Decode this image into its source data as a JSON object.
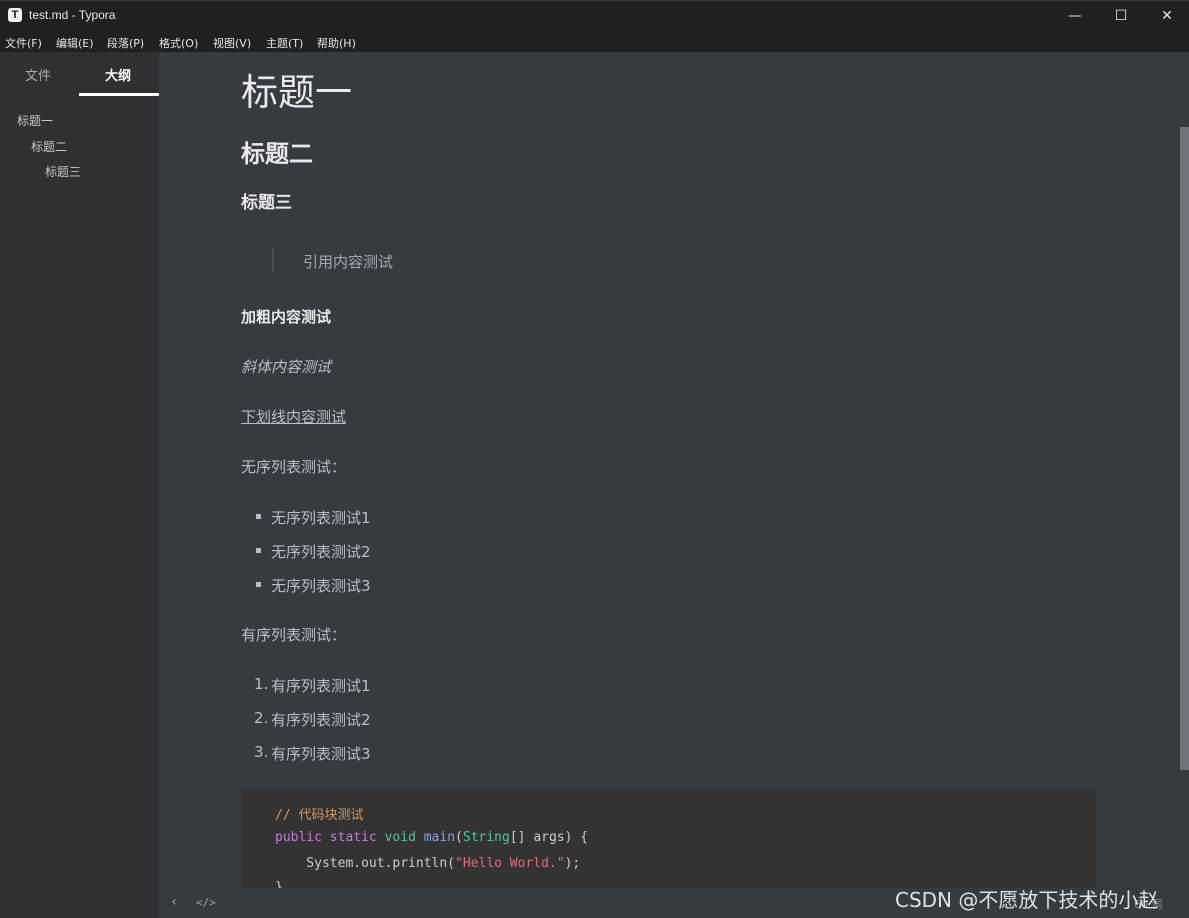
{
  "window": {
    "title": "test.md - Typora",
    "app_icon": "T",
    "controls": {
      "minimize": "—",
      "maximize": "☐",
      "close": "✕"
    }
  },
  "menu": [
    "文件(F)",
    "编辑(E)",
    "段落(P)",
    "格式(O)",
    "视图(V)",
    "主题(T)",
    "帮助(H)"
  ],
  "sidebar": {
    "tabs": {
      "files": "文件",
      "outline": "大纲"
    },
    "active_tab": "outline",
    "outline": [
      "标题一",
      "标题二",
      "标题三"
    ]
  },
  "document": {
    "h1": "标题一",
    "h2": "标题二",
    "h3": "标题三",
    "quote": "引用内容测试",
    "bold": "加粗内容测试",
    "italic": "斜体内容测试",
    "underline": "下划线内容测试",
    "ul_intro": "无序列表测试：",
    "ul": [
      "无序列表测试1",
      "无序列表测试2",
      "无序列表测试3"
    ],
    "ol_intro": "有序列表测试：",
    "ol_numbers": [
      "1.",
      "2.",
      "3."
    ],
    "ol": [
      "有序列表测试1",
      "有序列表测试2",
      "有序列表测试3"
    ],
    "code": {
      "comment": "// 代码块测试",
      "kw_public": "public",
      "kw_static": "static",
      "kw_void": "void",
      "fn_main": "main",
      "paren_open": "(",
      "type_string": "String",
      "args": "[] args) {",
      "println_prefix": "    System.out.println(",
      "string_literal": "\"Hello World.\"",
      "println_suffix": ");",
      "closing": "}"
    }
  },
  "footer": {
    "back_icon": "‹",
    "source_icon": "</>",
    "word_count": "60 词"
  },
  "watermark": "CSDN @不愿放下技术的小赵"
}
